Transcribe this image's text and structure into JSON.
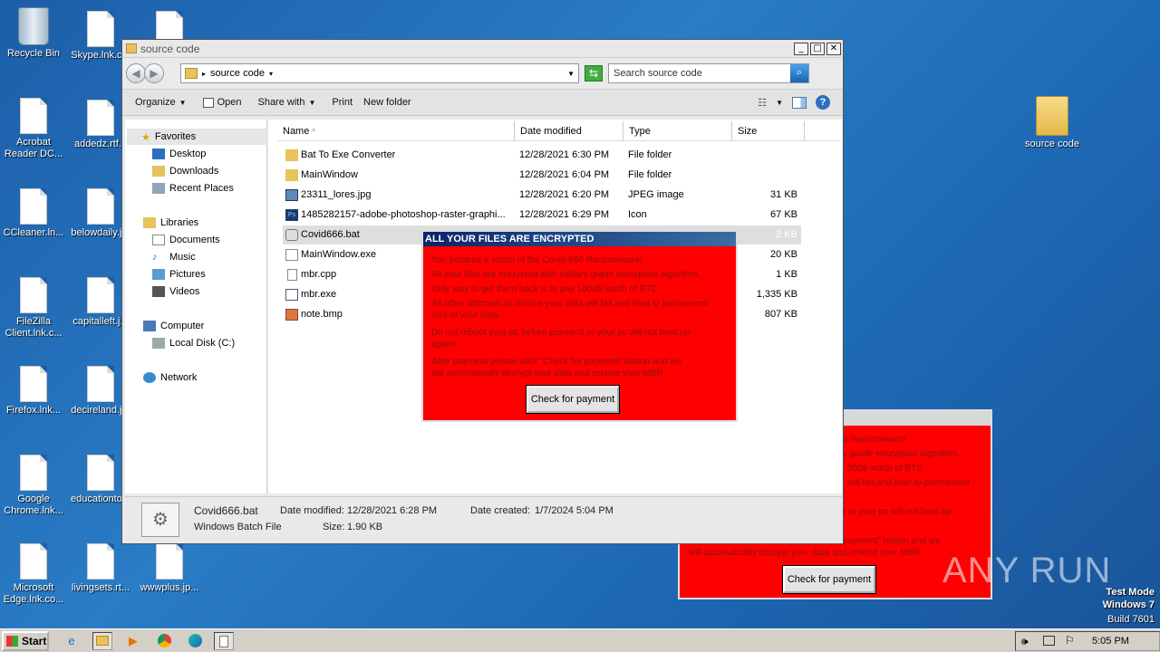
{
  "desktop": {
    "icons": [
      {
        "label": "Recycle Bin"
      },
      {
        "label": "Skype.lnk.c..."
      },
      {
        "label": ""
      },
      {
        "label": "Acrobat Reader DC..."
      },
      {
        "label": "addedz.rtf..."
      },
      {
        "label": "CCleaner.ln..."
      },
      {
        "label": "belowdaily.j..."
      },
      {
        "label": "FileZilla Client.lnk.c..."
      },
      {
        "label": "capitalleft.j..."
      },
      {
        "label": "Firefox.lnk..."
      },
      {
        "label": "decireland.j..."
      },
      {
        "label": "Google Chrome.lnk..."
      },
      {
        "label": "educationto..."
      },
      {
        "label": "Microsoft Edge.lnk.co..."
      },
      {
        "label": "livingsets.rt..."
      },
      {
        "label": "wwwplus.jp..."
      },
      {
        "label": "source code"
      }
    ]
  },
  "explorer": {
    "title": "source code",
    "breadcrumb": "source code",
    "search_placeholder": "Search source code",
    "toolbar": {
      "organize": "Organize",
      "open": "Open",
      "share_with": "Share with",
      "print": "Print",
      "new_folder": "New folder"
    },
    "nav": {
      "favorites": "Favorites",
      "desktop": "Desktop",
      "downloads": "Downloads",
      "recent_places": "Recent Places",
      "libraries": "Libraries",
      "documents": "Documents",
      "music": "Music",
      "pictures": "Pictures",
      "videos": "Videos",
      "computer": "Computer",
      "local_disk": "Local Disk (C:)",
      "network": "Network"
    },
    "columns": {
      "name": "Name",
      "date_modified": "Date modified",
      "type": "Type",
      "size": "Size"
    },
    "files": [
      {
        "name": "Bat To Exe Converter",
        "date": "12/28/2021 6:30 PM",
        "type": "File folder",
        "size": ""
      },
      {
        "name": "MainWindow",
        "date": "12/28/2021 6:04 PM",
        "type": "File folder",
        "size": ""
      },
      {
        "name": "23311_lores.jpg",
        "date": "12/28/2021 6:20 PM",
        "type": "JPEG image",
        "size": "31 KB"
      },
      {
        "name": "1485282157-adobe-photoshop-raster-graphi...",
        "date": "12/28/2021 6:29 PM",
        "type": "Icon",
        "size": "67 KB"
      },
      {
        "name": "Covid666.bat",
        "date": "",
        "type": "",
        "size": "2 KB"
      },
      {
        "name": "MainWindow.exe",
        "date": "",
        "type": "",
        "size": "20 KB"
      },
      {
        "name": "mbr.cpp",
        "date": "",
        "type": "",
        "size": "1 KB"
      },
      {
        "name": "mbr.exe",
        "date": "",
        "type": "",
        "size": "1,335 KB"
      },
      {
        "name": "note.bmp",
        "date": "",
        "type": "",
        "size": "807 KB"
      }
    ],
    "details": {
      "filename": "Covid666.bat",
      "filetype": "Windows Batch File",
      "modified_label": "Date modified:",
      "modified": "12/28/2021 6:28 PM",
      "created_label": "Date created:",
      "created": "1/7/2024 5:04 PM",
      "size_label": "Size:",
      "size": "1.90 KB"
    }
  },
  "ransom_dialog": {
    "title": "ALL YOUR FILES ARE ENCRYPTED",
    "lines": [
      "You became a victim of the Covid-666 Ransomware!",
      "All your files are encrypted with military grade encryption algorithm.",
      "Only way to get them back is to pay 1000$ worth of BTC",
      "All other attempts to restore your data will fail and lead to permament",
      "loss of your data",
      "Do not reboot your pc before payment or your pc will not boot up",
      "again!",
      "After payment please click \"Check for payment\" button and we",
      "will automatically decrypt your data and restore your MBR"
    ],
    "button": "Check for payment"
  },
  "ransom_dialog_back": {
    "lines": [
      "6 Ransomware!",
      "y grade encryption algorithm.",
      "000$ worth of BTC",
      "will fail and lead to permament",
      "t or your pc will not boot up",
      "payment\" button and we",
      "will automatically decrypt your data and restore your MBR"
    ],
    "button": "Check for payment"
  },
  "watermark": {
    "brand": "ANY RUN",
    "line1": "Test Mode",
    "line2": "Windows 7",
    "line3": "Build 7601"
  },
  "taskbar": {
    "start": "Start",
    "clock": "5:05 PM"
  }
}
